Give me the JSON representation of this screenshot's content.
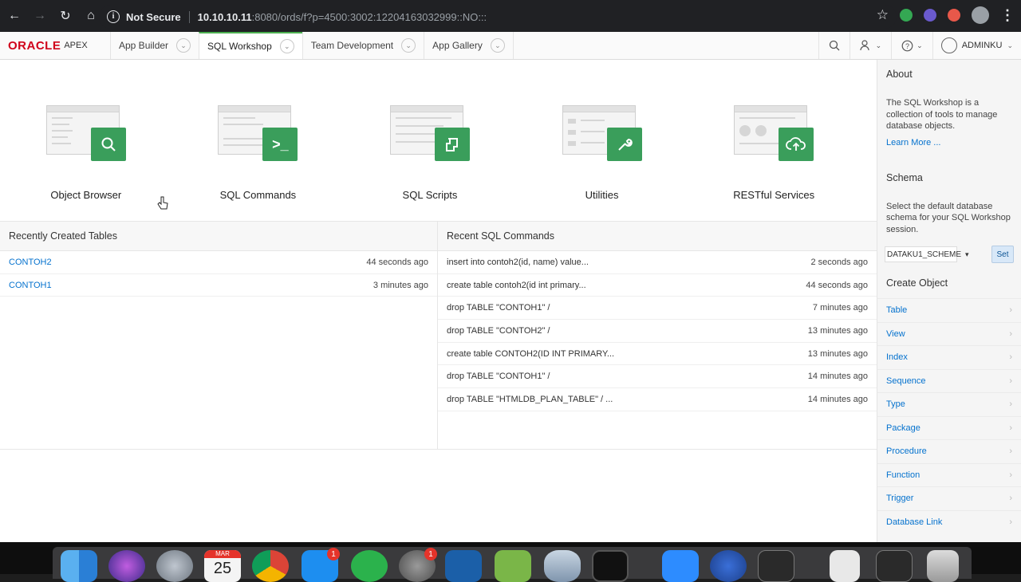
{
  "browser": {
    "security_label": "Not Secure",
    "url_host": "10.10.10.11",
    "url_path": ":8080/ords/f?p=4500:3002:12204163032999::NO:::"
  },
  "apex": {
    "logo_oracle": "ORACLE",
    "logo_apex": "APEX",
    "menus": [
      "App Builder",
      "SQL Workshop",
      "Team Development",
      "App Gallery"
    ],
    "active_menu": "SQL Workshop",
    "user": "ADMINKU"
  },
  "tiles": [
    {
      "label": "Object Browser",
      "icon": "search-icon"
    },
    {
      "label": "SQL Commands",
      "icon": "terminal-icon"
    },
    {
      "label": "SQL Scripts",
      "icon": "scroll-icon"
    },
    {
      "label": "Utilities",
      "icon": "wrench-icon"
    },
    {
      "label": "RESTful Services",
      "icon": "cloud-upload-icon"
    }
  ],
  "recent_tables": {
    "title": "Recently Created Tables",
    "rows": [
      {
        "name": "CONTOH2",
        "age": "44 seconds ago"
      },
      {
        "name": "CONTOH1",
        "age": "3 minutes ago"
      }
    ]
  },
  "recent_commands": {
    "title": "Recent SQL Commands",
    "rows": [
      {
        "cmd": "insert into contoh2(id, name) value...",
        "age": "2 seconds ago"
      },
      {
        "cmd": "create table contoh2(id int primary...",
        "age": "44 seconds ago"
      },
      {
        "cmd": "drop TABLE \"CONTOH1\" /",
        "age": "7 minutes ago"
      },
      {
        "cmd": "drop TABLE \"CONTOH2\" /",
        "age": "13 minutes ago"
      },
      {
        "cmd": "create table CONTOH2(ID INT PRIMARY...",
        "age": "13 minutes ago"
      },
      {
        "cmd": "drop TABLE \"CONTOH1\" /",
        "age": "14 minutes ago"
      },
      {
        "cmd": "drop TABLE \"HTMLDB_PLAN_TABLE\" / ...",
        "age": "14 minutes ago"
      }
    ]
  },
  "sidebar": {
    "about_title": "About",
    "about_text": "The SQL Workshop is a collection of tools to manage database objects.",
    "learn_more": "Learn More ...",
    "schema_title": "Schema",
    "schema_text": "Select the default database schema for your SQL Workshop session.",
    "schema_value": "DATAKU1_SCHEME",
    "set_label": "Set",
    "create_title": "Create Object",
    "create_items": [
      "Table",
      "View",
      "Index",
      "Sequence",
      "Type",
      "Package",
      "Procedure",
      "Function",
      "Trigger",
      "Database Link"
    ]
  },
  "dock": {
    "calendar_month": "MAR",
    "calendar_day": "25",
    "badges": [
      "1",
      "1"
    ]
  },
  "colors": {
    "oracle_red": "#d0021b",
    "apex_green": "#3a9e5b",
    "link_blue": "#0572ce",
    "active_tab": "#4caf50"
  }
}
